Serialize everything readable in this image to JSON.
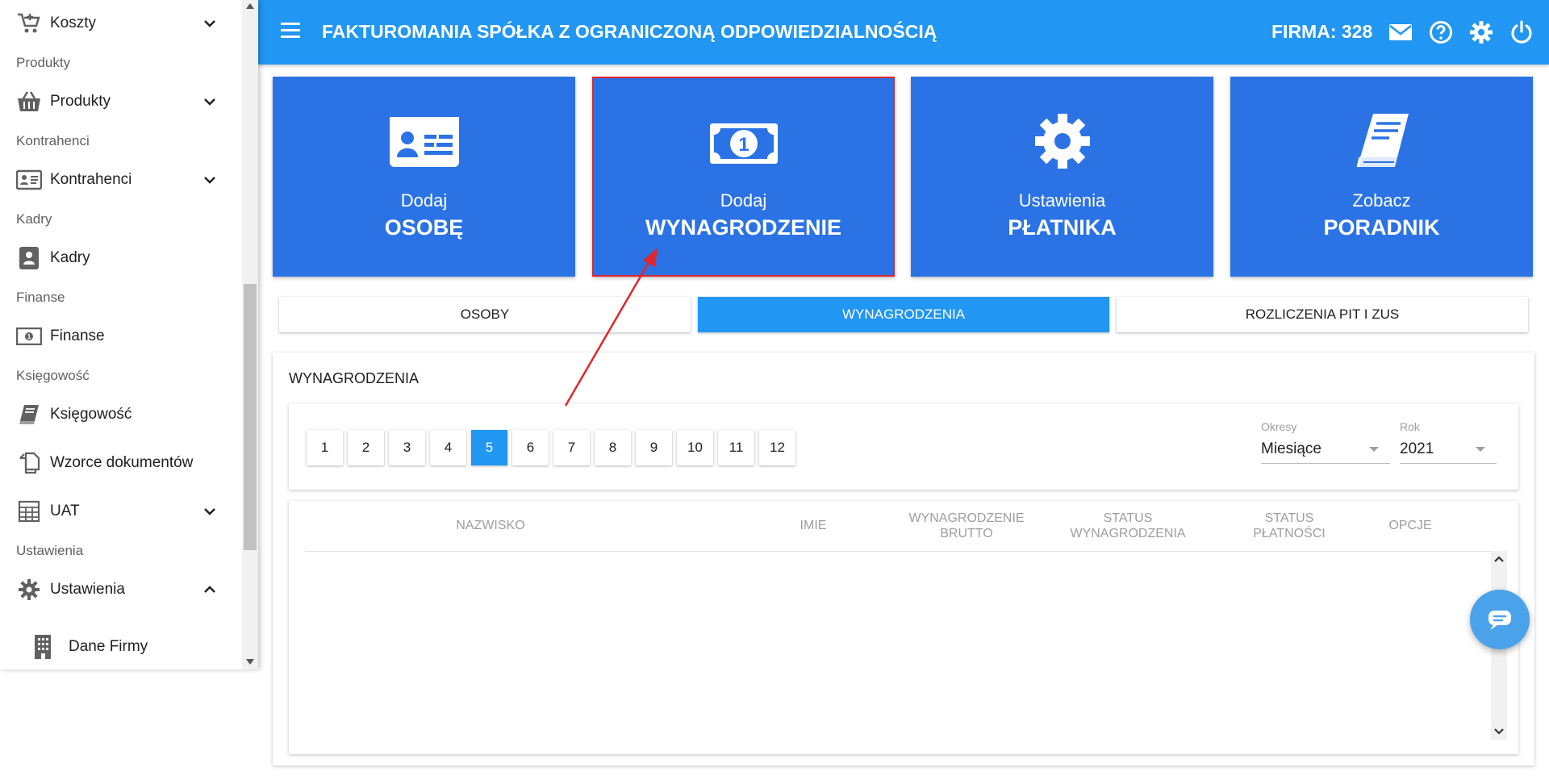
{
  "sidebar": {
    "koszty": "Koszty",
    "produkty_section": "Produkty",
    "produkty": "Produkty",
    "kontrahenci_section": "Kontrahenci",
    "kontrahenci": "Kontrahenci",
    "kadry_section": "Kadry",
    "kadry": "Kadry",
    "finanse_section": "Finanse",
    "finanse": "Finanse",
    "ksiegowosc_section": "Księgowość",
    "ksiegowosc": "Księgowość",
    "wzorce": "Wzorce dokumentów",
    "uat": "UAT",
    "ustawienia_section": "Ustawienia",
    "ustawienia": "Ustawienia",
    "dane_firmy": "Dane Firmy"
  },
  "topbar": {
    "title": "FAKTUROMANIA SPÓŁKA Z OGRANICZONĄ ODPOWIEDZIALNOŚCIĄ",
    "firma": "FIRMA: 328",
    "color": "#2196f3"
  },
  "tiles": [
    {
      "small": "Dodaj",
      "big": "OSOBĘ",
      "icon": "id-card-icon"
    },
    {
      "small": "Dodaj",
      "big": "WYNAGRODZENIE",
      "icon": "money-bill-icon"
    },
    {
      "small": "Ustawienia",
      "big": "PŁATNIKA",
      "icon": "gear-icon"
    },
    {
      "small": "Zobacz",
      "big": "PORADNIK",
      "icon": "book-icon"
    }
  ],
  "tabs": [
    {
      "label": "OSOBY",
      "active": false
    },
    {
      "label": "WYNAGRODZENIA",
      "active": true
    },
    {
      "label": "ROZLICZENIA PIT I ZUS",
      "active": false
    }
  ],
  "card": {
    "title": "WYNAGRODZENIA",
    "months": [
      "1",
      "2",
      "3",
      "4",
      "5",
      "6",
      "7",
      "8",
      "9",
      "10",
      "11",
      "12"
    ],
    "active_month": "5",
    "okresy_label": "Okresy",
    "okresy_value": "Miesiące",
    "rok_label": "Rok",
    "rok_value": "2021",
    "columns": {
      "nazwisko": "NAZWISKO",
      "imie": "IMIE",
      "brutto_1": "WYNAGRODZENIE",
      "brutto_2": "BRUTTO",
      "status_wyn_1": "STATUS",
      "status_wyn_2": "WYNAGRODZENIA",
      "status_plat_1": "STATUS",
      "status_plat_2": "PŁATNOŚCI",
      "opcje": "OPCJE"
    }
  },
  "colors": {
    "accent": "#2196f3",
    "tile": "#2b73e5",
    "annotation": "#e0262d"
  }
}
